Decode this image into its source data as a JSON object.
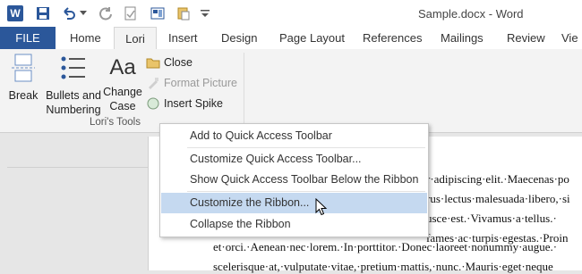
{
  "titlebar": {
    "logo": "W",
    "title": "Sample.docx - Word",
    "qat_icons": [
      "save-icon",
      "undo-icon",
      "redo-icon",
      "check-icon",
      "layout-icon",
      "paste-icon",
      "customize-qat-icon"
    ]
  },
  "tabs": [
    "FILE",
    "Home",
    "Lori",
    "Insert",
    "Design",
    "Page Layout",
    "References",
    "Mailings",
    "Review",
    "Vie"
  ],
  "ribbon": {
    "break_label": "Break",
    "bullets_label_1": "Bullets and",
    "bullets_label_2": "Numbering",
    "change_label_1": "Change",
    "change_label_2": "Case",
    "change_glyph": "Aa",
    "close_label": "Close",
    "format_picture_label": "Format Picture",
    "insert_spike_label": "Insert Spike",
    "group_label": "Lori's Tools"
  },
  "document": {
    "lines": [
      "r·adipiscing·elit.·Maecenas·po",
      "rus·lectus·malesuada·libero,·si",
      "usce·est.·Vivamus·a·tellus.·",
      "fames·ac·turpis·egestas.·Proin",
      "et·orci.·Aenean·nec·lorem.·In·porttitor.·Donec·laoreet·nonummy·augue.·",
      "scelerisque·at,·vulputate·vitae,·pretium·mattis,·nunc.·Mauris·eget·neque"
    ]
  },
  "context_menu": {
    "items": [
      "Add to Quick Access Toolbar",
      "Customize Quick Access Toolbar...",
      "Show Quick Access Toolbar Below the Ribbon",
      "Customize the Ribbon...",
      "Collapse the Ribbon"
    ],
    "highlighted_index": 3
  },
  "colors": {
    "file_tab": "#2b579a",
    "highlight": "#c5d9f0"
  }
}
